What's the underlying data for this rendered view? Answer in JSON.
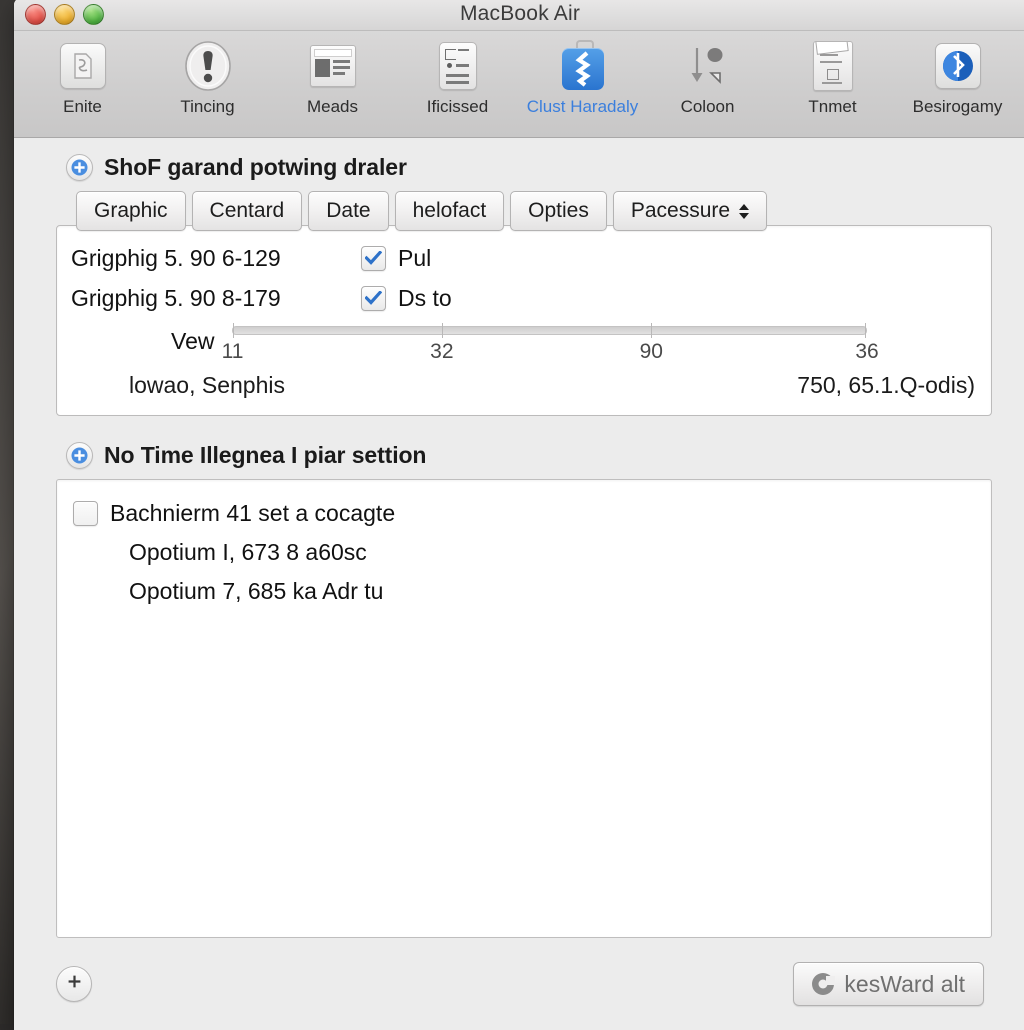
{
  "window": {
    "title": "MacBook Air",
    "traffic_lights": [
      "close",
      "minimize",
      "zoom"
    ],
    "accent_color": "#3b7fdd",
    "chrome_color": "#d6d5d5",
    "body_color": "#ececec"
  },
  "toolbar": {
    "items": [
      {
        "label": "Enite",
        "icon": "document-card-icon",
        "selected": false
      },
      {
        "label": "Tincing",
        "icon": "alert-exclamation-icon",
        "selected": false
      },
      {
        "label": "Meads",
        "icon": "news-article-icon",
        "selected": false
      },
      {
        "label": "Ificissed",
        "icon": "list-detail-icon",
        "selected": false
      },
      {
        "label": "Clust Haradaly",
        "icon": "blue-zipper-disk-icon",
        "selected": true
      },
      {
        "label": "Coloon",
        "icon": "download-arrow-icon",
        "selected": false
      },
      {
        "label": "Tnmet",
        "icon": "printer-document-icon",
        "selected": false
      },
      {
        "label": "Besirogamy",
        "icon": "bluetooth-icon",
        "selected": false
      }
    ]
  },
  "section_one": {
    "disclosure_icon": "plus-circle-icon",
    "title": "ShoF garand potwing draler",
    "tabs": [
      {
        "label": "Graphic",
        "selected": false,
        "stepper": false
      },
      {
        "label": "Centard",
        "selected": false,
        "stepper": false
      },
      {
        "label": "Date",
        "selected": false,
        "stepper": false
      },
      {
        "label": "helofact",
        "selected": false,
        "stepper": false
      },
      {
        "label": "Opties",
        "selected": false,
        "stepper": false
      },
      {
        "label": "Pacessure",
        "selected": false,
        "stepper": true
      }
    ],
    "rows": [
      {
        "label": "Grigphig 5. 90 6-129",
        "checked": true,
        "checkbox_label": "Pul"
      },
      {
        "label": "Grigphig 5. 90 8-179",
        "checked": true,
        "checkbox_label": "Ds to"
      }
    ],
    "slider": {
      "label": "Vew",
      "tick_labels": [
        "11",
        "32",
        "90",
        "36"
      ],
      "tick_positions_pct": [
        0,
        33,
        66,
        100
      ],
      "min": "11",
      "max": "36"
    },
    "footer_left": "lowao, Senphis",
    "footer_right": "750, 65.1.Q-odis)"
  },
  "section_two": {
    "disclosure_icon": "plus-circle-icon",
    "title": "No Time Illegnea I piar settion",
    "list": [
      {
        "label": "Bachnierm 41 set a cocagte",
        "checkbox": true,
        "checked": false,
        "indent": false
      },
      {
        "label": "Opotium I, 673 8 a60sc",
        "checkbox": false,
        "checked": false,
        "indent": true
      },
      {
        "label": "Opotium 7, 685 ka Adr tu",
        "checkbox": false,
        "checked": false,
        "indent": true
      }
    ]
  },
  "bottom_bar": {
    "add_button_label": "+",
    "add_button_icon": "plus-icon",
    "action_button_label": "kesWard alt",
    "action_button_icon": "spinner-circle-icon"
  },
  "chart_data": {
    "type": "slider-scale",
    "categories": [
      "11",
      "32",
      "90",
      "36"
    ],
    "values": [
      11,
      32,
      90,
      36
    ],
    "title": "Vew",
    "xlabel": "",
    "ylabel": "",
    "xlim": [
      11,
      36
    ],
    "grid": false
  }
}
